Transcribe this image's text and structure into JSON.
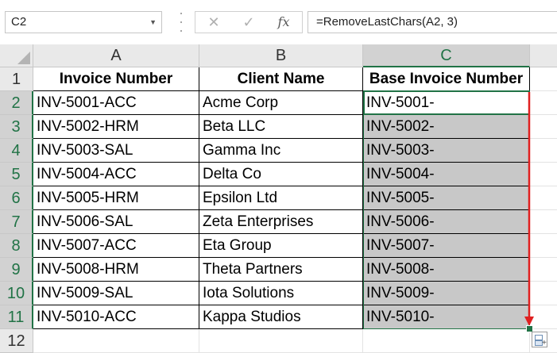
{
  "formula_bar": {
    "name_box": "C2",
    "name_box_dropdown": "▼",
    "cancel_glyph": "✕",
    "enter_glyph": "✓",
    "fx_label": "fx",
    "formula": "=RemoveLastChars(A2, 3)"
  },
  "columns": [
    "A",
    "B",
    "C"
  ],
  "row_numbers": [
    "1",
    "2",
    "3",
    "4",
    "5",
    "6",
    "7",
    "8",
    "9",
    "10",
    "11",
    "12"
  ],
  "table": {
    "headers": [
      "Invoice Number",
      "Client Name",
      "Base Invoice Number"
    ],
    "rows": [
      [
        "INV-5001-ACC",
        "Acme Corp",
        "INV-5001-"
      ],
      [
        "INV-5002-HRM",
        "Beta LLC",
        "INV-5002-"
      ],
      [
        "INV-5003-SAL",
        "Gamma Inc",
        "INV-5003-"
      ],
      [
        "INV-5004-ACC",
        "Delta Co",
        "INV-5004-"
      ],
      [
        "INV-5005-HRM",
        "Epsilon Ltd",
        "INV-5005-"
      ],
      [
        "INV-5006-SAL",
        "Zeta Enterprises",
        "INV-5006-"
      ],
      [
        "INV-5007-ACC",
        "Eta Group",
        "INV-5007-"
      ],
      [
        "INV-5008-HRM",
        "Theta Partners",
        "INV-5008-"
      ],
      [
        "INV-5009-SAL",
        "Iota Solutions",
        "INV-5009-"
      ],
      [
        "INV-5010-ACC",
        "Kappa Studios",
        "INV-5010-"
      ]
    ]
  },
  "colors": {
    "selection_green": "#217346",
    "arrow_red": "#e02020",
    "selected_fill": "#c8c8c8"
  },
  "icons": {
    "quick_analysis": "quick-analysis-icon",
    "fill_arrow": "fill-down-arrow-icon"
  }
}
